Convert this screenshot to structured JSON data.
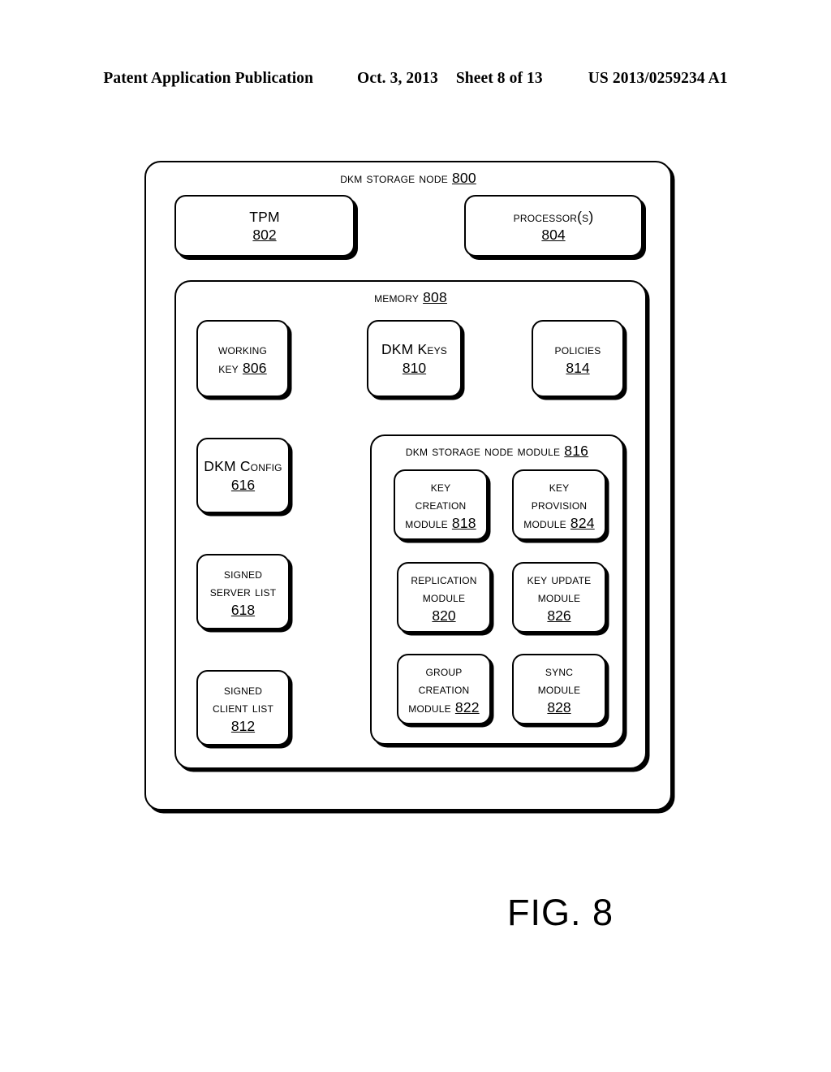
{
  "header": {
    "publication": "Patent Application Publication",
    "date": "Oct. 3, 2013",
    "sheet": "Sheet 8 of 13",
    "patent_number": "US 2013/0259234 A1"
  },
  "figure": {
    "caption": "FIG. 8"
  },
  "diagram": {
    "outer": {
      "title_text": "DKM Storage Node",
      "title_num": "800"
    },
    "tpm": {
      "line1": "TPM",
      "num": "802"
    },
    "processors": {
      "line1": "Processor(s)",
      "num": "804"
    },
    "memory": {
      "title_text": "Memory",
      "title_num": "808"
    },
    "working_key": {
      "line1": "Working",
      "line2": "Key",
      "num": "806"
    },
    "dkm_keys": {
      "line1": "DKM Keys",
      "num": "810"
    },
    "policies": {
      "line1": "Policies",
      "num": "814"
    },
    "dkm_config": {
      "line1": "DKM Config",
      "num": "616"
    },
    "signed_server_list": {
      "line1": "Signed",
      "line2": "Server List",
      "num": "618"
    },
    "signed_client_list": {
      "line1": "Signed",
      "line2": "Client List",
      "num": "812"
    },
    "module_container": {
      "title_text": "DKM Storage Node Module",
      "title_num": "816"
    },
    "key_creation_module": {
      "line1": "Key",
      "line2": "Creation",
      "line3": "Module",
      "num": "818"
    },
    "key_provision_module": {
      "line1": "Key",
      "line2": "Provision",
      "line3": "Module",
      "num": "824"
    },
    "replication_module": {
      "line1": "Replication",
      "line2": "Module",
      "num": "820"
    },
    "key_update_module": {
      "line1": "Key Update",
      "line2": "Module",
      "num": "826"
    },
    "group_creation_module": {
      "line1": "Group",
      "line2": "Creation",
      "line3": "Module",
      "num": "822"
    },
    "sync_module": {
      "line1": "Sync",
      "line2": "Module",
      "num": "828"
    }
  },
  "colors": {
    "ink": "#000000",
    "paper": "#ffffff"
  }
}
